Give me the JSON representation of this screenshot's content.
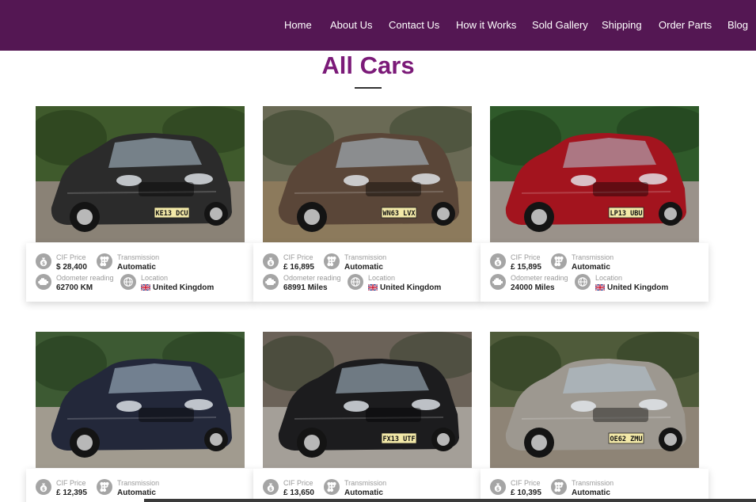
{
  "nav": {
    "items": [
      {
        "label": "Home",
        "slug": "home"
      },
      {
        "label": "About Us",
        "slug": "about-us"
      },
      {
        "label": "Contact Us",
        "slug": "contact-us"
      },
      {
        "label": "How it Works",
        "slug": "how-it-works"
      },
      {
        "label": "Sold Gallery",
        "slug": "sold-gallery"
      },
      {
        "label": "Shipping",
        "slug": "shipping"
      },
      {
        "label": "Order Parts",
        "slug": "order-parts"
      },
      {
        "label": "Blog",
        "slug": "blog"
      }
    ]
  },
  "page": {
    "title": "All Cars"
  },
  "labels": {
    "price": "CIF Price",
    "transmission": "Transmission",
    "odometer": "Odometer reading",
    "location": "Location"
  },
  "cars": [
    {
      "price": "$ 28,400",
      "transmission": "Automatic",
      "odometer": "62700 KM",
      "location": "United Kingdom",
      "plate": "KE13 DCU",
      "color": "#2b2b2b"
    },
    {
      "price": "£ 16,895",
      "transmission": "Automatic",
      "odometer": "68991 Miles",
      "location": "United Kingdom",
      "plate": "WN63 LVX",
      "color": "#5a4638"
    },
    {
      "price": "£ 15,895",
      "transmission": "Automatic",
      "odometer": "24000 Miles",
      "location": "United Kingdom",
      "plate": "LP13 UBU",
      "color": "#a3141e"
    },
    {
      "price": "£ 12,395",
      "transmission": "Automatic",
      "plate": "",
      "color": "#23283a"
    },
    {
      "price": "£ 13,650",
      "transmission": "Automatic",
      "plate": "FX13 UTF",
      "color": "#1c1c1e"
    },
    {
      "price": "£ 10,395",
      "transmission": "Automatic",
      "plate": "OE62 ZMU",
      "color": "#9d9890"
    }
  ],
  "colors": {
    "navbar_bg": "#541753",
    "title": "#7b1a78",
    "icon_bg": "#a5a5a5"
  }
}
